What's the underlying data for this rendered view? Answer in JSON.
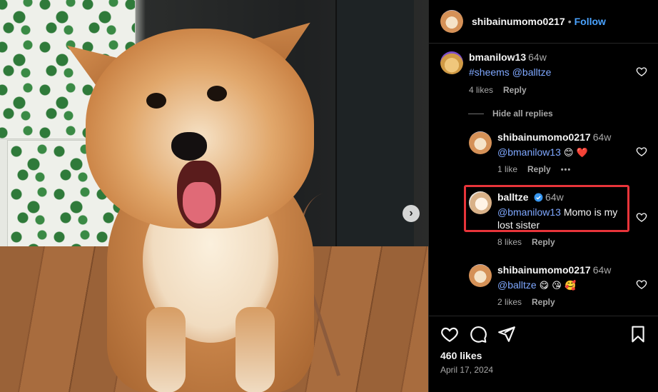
{
  "post": {
    "author": "shibainumomo0217",
    "follow_label": "Follow",
    "dot": "•",
    "likes": "460 likes",
    "date": "April 17, 2024"
  },
  "hide_replies": "Hide all replies",
  "comments": [
    {
      "user": "bmanilow13",
      "time": "64w",
      "mentions": [
        "#sheems",
        "@balltze"
      ],
      "likes": "4 likes",
      "reply": "Reply"
    },
    {
      "user": "shibainumomo0217",
      "time": "64w",
      "mention": "@bmanilow13",
      "emojis": "😊 ❤️",
      "likes": "1 like",
      "reply": "Reply",
      "more": "•••"
    },
    {
      "user": "balltze",
      "verified": true,
      "time": "64w",
      "mention": "@bmanilow13",
      "text": "Momo is my lost sister",
      "likes": "8 likes",
      "reply": "Reply",
      "highlighted": true
    },
    {
      "user": "shibainumomo0217",
      "time": "64w",
      "mention": "@balltze",
      "emojis": "😋 😘 🥰",
      "likes": "2 likes",
      "reply": "Reply"
    }
  ],
  "icons": {
    "next": "chevron-right-icon",
    "like": "heart-icon",
    "comment": "comment-icon",
    "share": "send-icon",
    "save": "bookmark-icon",
    "verified": "verified-badge-icon"
  },
  "colors": {
    "accent": "#4aa3ff",
    "mention": "#7fa8ff",
    "highlight_border": "#e8343a",
    "heart_red": "#ff3040"
  }
}
